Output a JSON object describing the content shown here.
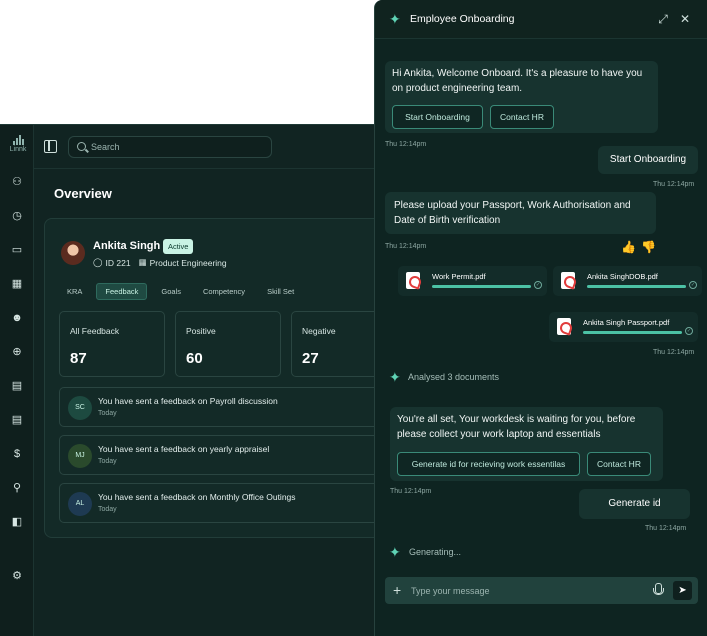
{
  "app": {
    "logo_text": "Linnk",
    "search_placeholder": "Search",
    "page_title": "Overview",
    "nav_icons": [
      "users-icon",
      "clock-icon",
      "card-icon",
      "calendar-icon",
      "user-check-icon",
      "plus-circle-icon",
      "calendar-alt-icon",
      "document-icon",
      "dollar-icon",
      "award-icon",
      "folder-icon",
      "settings-icon"
    ],
    "profile": {
      "name": "Ankita Singh",
      "status": "Active",
      "id": "ID 221",
      "department": "Product Engineering"
    },
    "tabs": [
      {
        "label": "KRA",
        "active": false
      },
      {
        "label": "Feedback",
        "active": true
      },
      {
        "label": "Goals",
        "active": false
      },
      {
        "label": "Competency",
        "active": false
      },
      {
        "label": "Skill Set",
        "active": false
      }
    ],
    "stats": [
      {
        "label": "All Feedback",
        "value": "87"
      },
      {
        "label": "Positive",
        "value": "60"
      },
      {
        "label": "Negative",
        "value": "27"
      }
    ],
    "feedback": [
      {
        "initials": "SC",
        "text": "You have sent a feedback on Payroll discussion",
        "time": "Today",
        "color": "#1d4a40"
      },
      {
        "initials": "MJ",
        "text": "You have sent a feedback on yearly appraisel",
        "time": "Today",
        "color": "#2a4a2c"
      },
      {
        "initials": "AL",
        "text": "You have sent a feedback on Monthly Office Outings",
        "time": "Today",
        "color": "#1e3a52"
      }
    ]
  },
  "chat": {
    "title": "Employee Onboarding",
    "welcome": "Hi Ankita, Welcome Onboard. It's a pleasure to have you on product engineering team.",
    "welcome_buttons": [
      "Start Onboarding",
      "Contact HR"
    ],
    "welcome_time": "Thu 12:14pm",
    "user_msg_1": "Start Onboarding",
    "user_msg_1_time": "Thu 12:14pm",
    "upload_request": "Please upload your Passport, Work Authorisation and Date of Birth verification",
    "upload_time": "Thu 12:14pm",
    "documents": [
      {
        "name": "Work Permit.pdf",
        "progress": 1.0
      },
      {
        "name": "Ankita SinghDOB.pdf",
        "progress": 1.0
      },
      {
        "name": "Ankita Singh Passport.pdf",
        "progress": 1.0
      }
    ],
    "docs_time": "Thu 12:14pm",
    "analysed": "Analysed 3 documents",
    "ready_msg": "You're all set, Your workdesk is waiting for you, before please collect your work laptop and essentials",
    "ready_buttons": [
      "Generate id for recieving work essentilas",
      "Contact HR"
    ],
    "ready_time": "Thu 12:14pm",
    "user_msg_2": "Generate id",
    "user_msg_2_time": "Thu 12:14pm",
    "generating": "Generating...",
    "composer_placeholder": "Type your message"
  }
}
